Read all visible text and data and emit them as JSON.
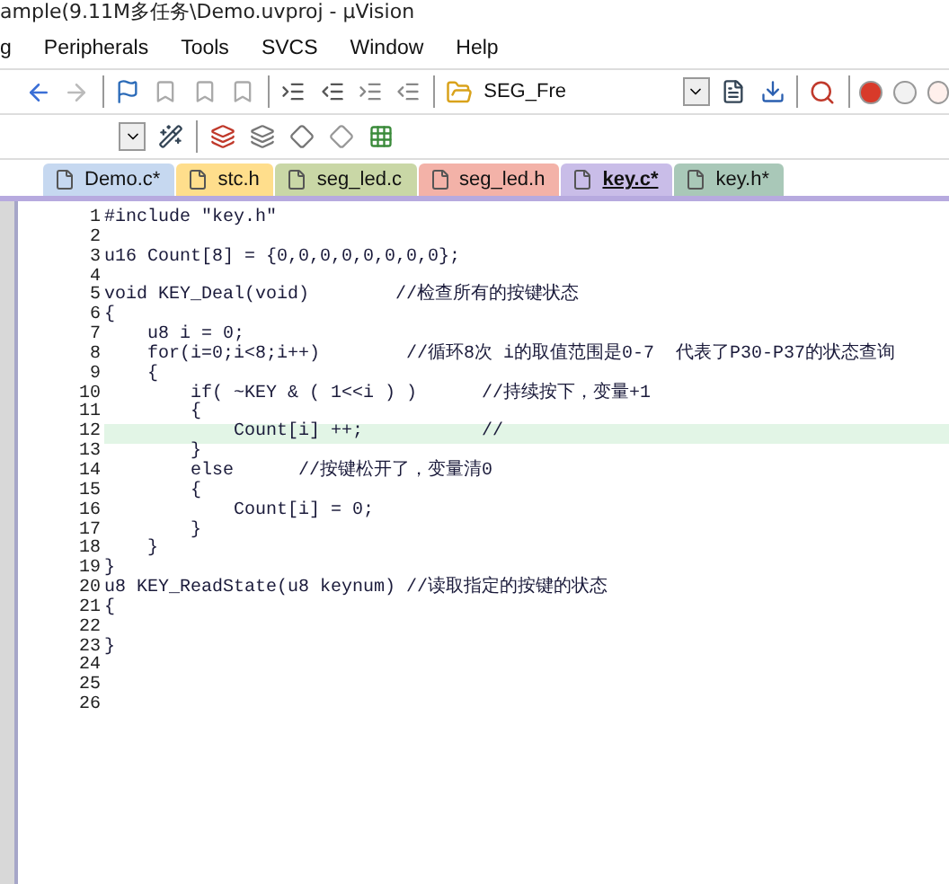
{
  "window": {
    "title": "ample(9.11M多任务\\Demo.uvproj - µVision"
  },
  "menu": [
    "g",
    "Peripherals",
    "Tools",
    "SVCS",
    "Window",
    "Help"
  ],
  "toolbar": {
    "target": "SEG_Fre"
  },
  "tabs": [
    {
      "label": "Demo.c*",
      "color": "#c6d8f0",
      "selected": false
    },
    {
      "label": "stc.h",
      "color": "#ffde8c",
      "selected": false
    },
    {
      "label": "seg_led.c",
      "color": "#c9d7a6",
      "selected": false
    },
    {
      "label": "seg_led.h",
      "color": "#f3b2a8",
      "selected": false
    },
    {
      "label": "key.c*",
      "color": "#c9bde8",
      "selected": true
    },
    {
      "label": "key.h*",
      "color": "#a9c8b8",
      "selected": false
    }
  ],
  "editor": {
    "lines": [
      {
        "number": "1",
        "code": "#include \"key.h\"",
        "current": false
      },
      {
        "number": "2",
        "current": false
      },
      {
        "number": "3",
        "code": "u16 Count[8] = {0,0,0,0,0,0,0,0};",
        "current": false
      },
      {
        "number": "4",
        "current": false
      },
      {
        "number": "5",
        "code": "void KEY_Deal(void)        //检查所有的按键状态",
        "current": false
      },
      {
        "number": "6",
        "code": "{",
        "current": false
      },
      {
        "number": "7",
        "code": "    u8 i = 0;",
        "current": false
      },
      {
        "number": "8",
        "code": "    for(i=0;i<8;i++)        //循环8次 i的取值范围是0-7  代表了P30-P37的状态查询",
        "current": false
      },
      {
        "number": "9",
        "code": "    {",
        "current": false
      },
      {
        "number": "10",
        "code": "        if( ~KEY & ( 1<<i ) )      //持续按下，变量+1",
        "current": false
      },
      {
        "number": "11",
        "code": "        {",
        "current": false
      },
      {
        "number": "12",
        "code": "            Count[i] ++;           //",
        "current": true
      },
      {
        "number": "13",
        "code": "        }",
        "current": false
      },
      {
        "number": "14",
        "code": "        else      //按键松开了，变量清0",
        "current": false
      },
      {
        "number": "15",
        "code": "        {",
        "current": false
      },
      {
        "number": "16",
        "code": "            Count[i] = 0;",
        "current": false
      },
      {
        "number": "17",
        "code": "        }",
        "current": false
      },
      {
        "number": "18",
        "code": "    }",
        "current": false
      },
      {
        "number": "19",
        "code": "}",
        "current": false
      },
      {
        "number": "20",
        "code": "u8 KEY_ReadState(u8 keynum) //读取指定的按键的状态",
        "current": false
      },
      {
        "number": "21",
        "code": "{",
        "current": false
      },
      {
        "number": "22",
        "current": false
      },
      {
        "number": "23",
        "code": "}",
        "current": false
      },
      {
        "number": "24",
        "current": false
      },
      {
        "number": "25",
        "current": false
      },
      {
        "number": "26",
        "current": false
      }
    ]
  }
}
